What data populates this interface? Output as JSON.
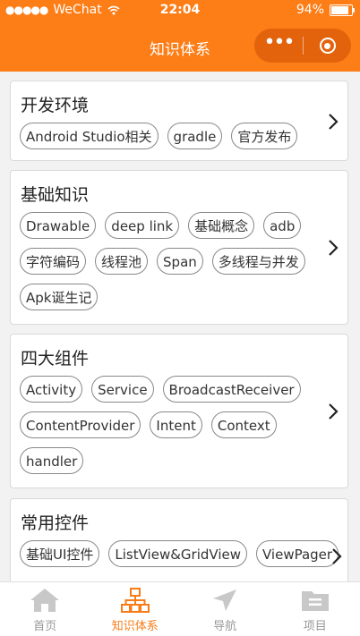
{
  "status": {
    "carrier": "WeChat",
    "time": "22:04",
    "battery": "94%",
    "battery_level": 0.94
  },
  "nav": {
    "title": "知识体系"
  },
  "cards": [
    {
      "title": "开发环境",
      "tags": [
        "Android Studio相关",
        "gradle",
        "官方发布"
      ]
    },
    {
      "title": "基础知识",
      "tags": [
        "Drawable",
        "deep link",
        "基础概念",
        "adb",
        "字符编码",
        "线程池",
        "Span",
        "多线程与并发",
        "Apk诞生记"
      ]
    },
    {
      "title": "四大组件",
      "tags": [
        "Activity",
        "Service",
        "BroadcastReceiver",
        "ContentProvider",
        "Intent",
        "Context",
        "handler"
      ]
    },
    {
      "title": "常用控件",
      "tags": [
        "基础UI控件",
        "ListView&GridView",
        "ViewPager"
      ]
    }
  ],
  "tabs": [
    {
      "label": "首页",
      "icon": "home-icon"
    },
    {
      "label": "知识体系",
      "icon": "hierarchy-icon"
    },
    {
      "label": "导航",
      "icon": "navigation-icon"
    },
    {
      "label": "项目",
      "icon": "folder-icon"
    }
  ],
  "colors": {
    "accent": "#fd7d17",
    "tab_inactive": "#c8c8c8",
    "tab_active": "#f97c18"
  }
}
